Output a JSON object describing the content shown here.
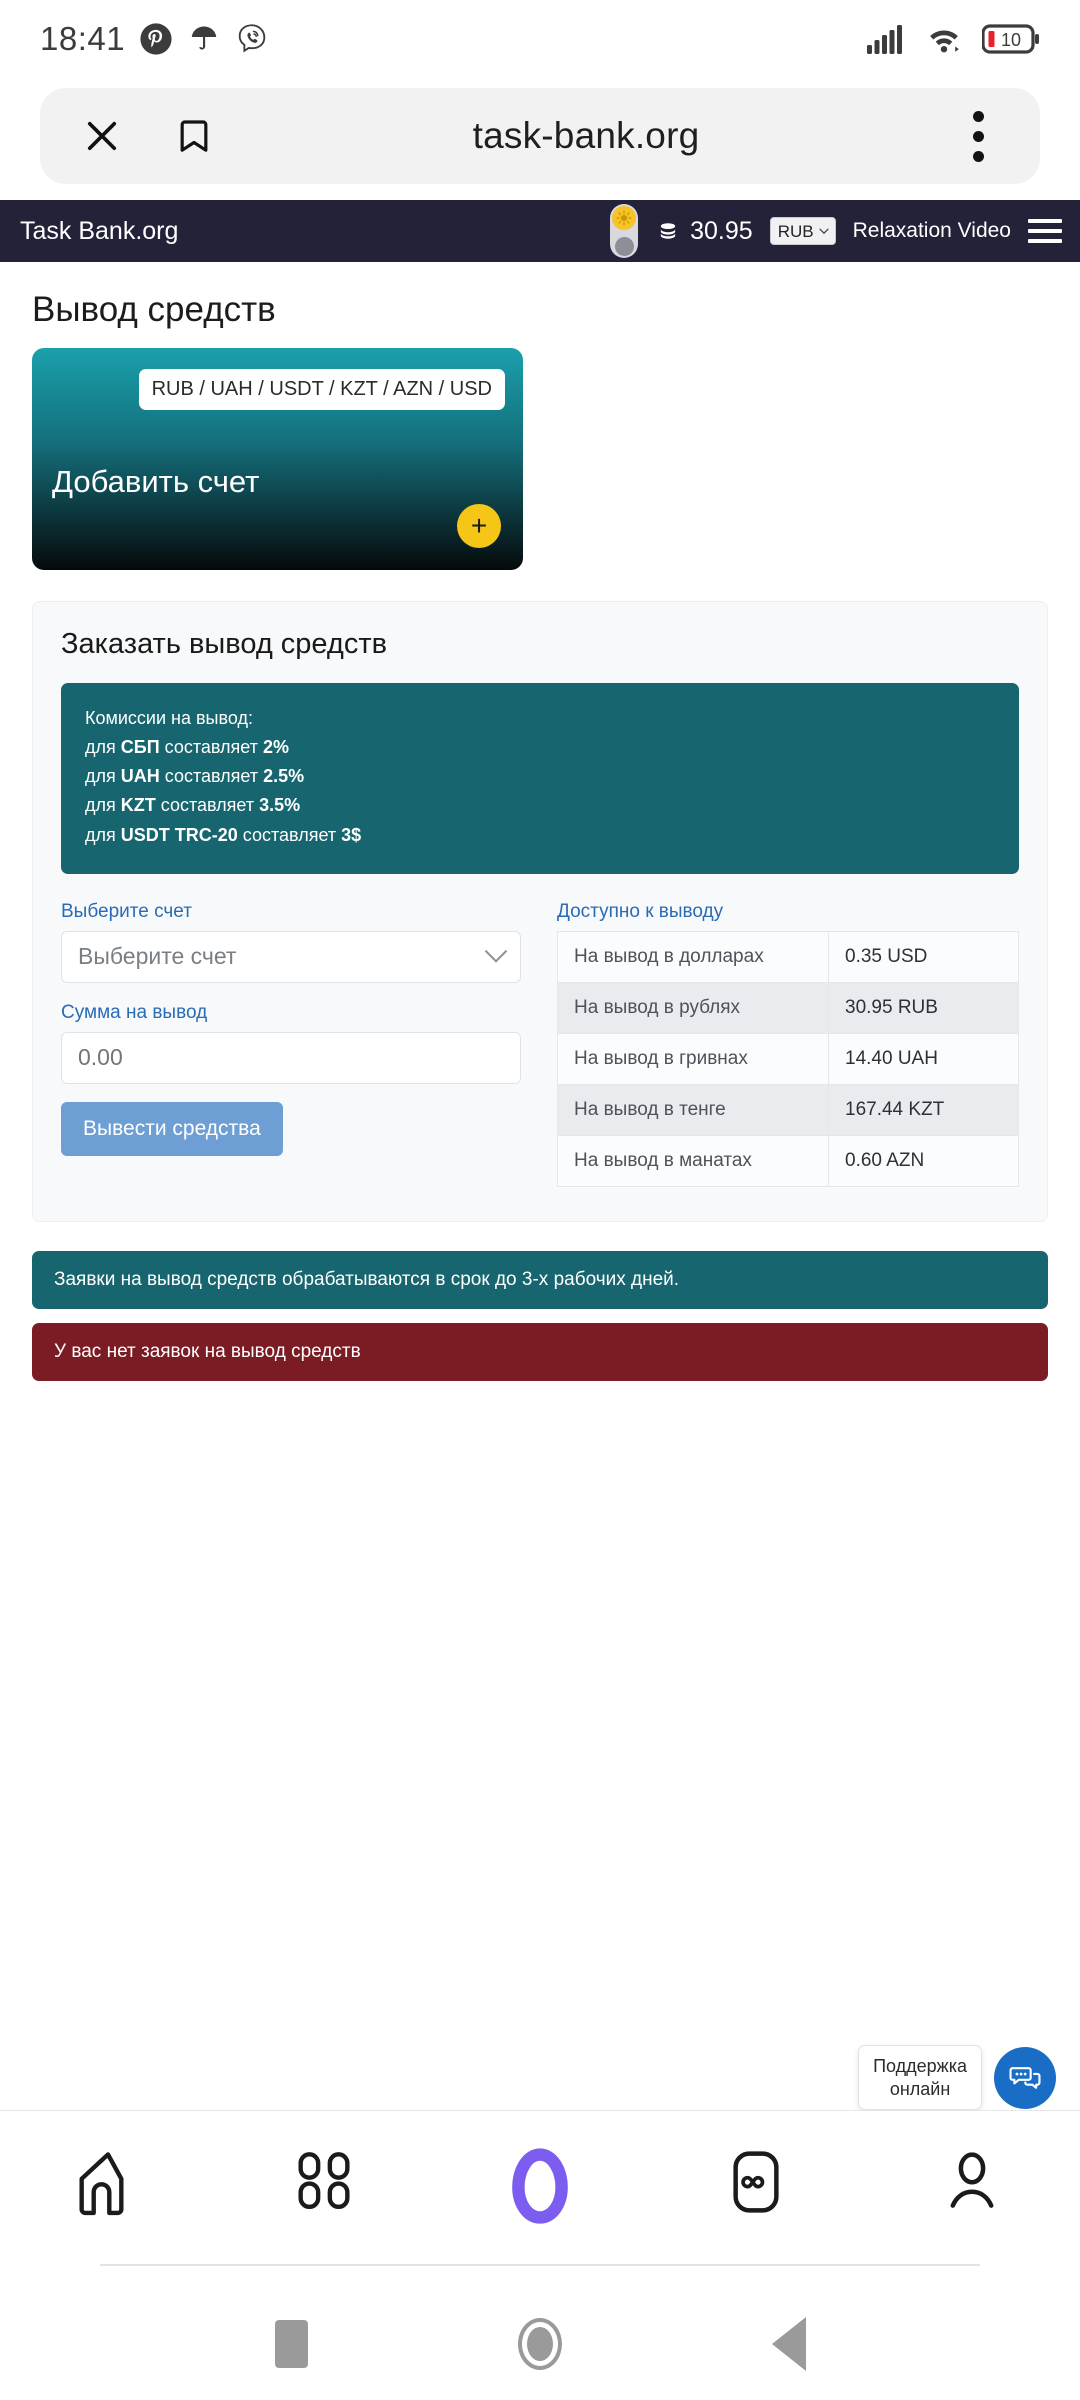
{
  "status_bar": {
    "time": "18:41",
    "notification_icons": [
      "pinterest-icon",
      "umbrella-icon",
      "viber-icon"
    ],
    "signal_icon": "cellular-signal-icon",
    "wifi_icon": "wifi-icon",
    "battery_level": "10"
  },
  "browser": {
    "url": "task-bank.org",
    "close_icon": "close-icon",
    "bookmark_icon": "bookmark-icon",
    "menu_icon": "overflow-menu-icon",
    "bottom_nav": [
      {
        "name": "home",
        "icon": "home-icon"
      },
      {
        "name": "apps",
        "icon": "grid-apps-icon"
      },
      {
        "name": "alice",
        "icon": "alice-assistant-icon"
      },
      {
        "name": "tabs",
        "icon": "infinity-tabs-icon"
      },
      {
        "name": "profile",
        "icon": "profile-icon"
      }
    ]
  },
  "android_nav": {
    "recents_icon": "recents-square-icon",
    "home_icon": "home-circle-icon",
    "back_icon": "back-triangle-icon"
  },
  "site_header": {
    "brand": "Task Bank.org",
    "theme_toggle_icon": "sun-moon-toggle-icon",
    "coins_icon": "coins-icon",
    "balance": "30.95",
    "currency_selected": "RUB",
    "currency_options": [
      "RUB",
      "UAH",
      "USDT",
      "KZT",
      "AZN",
      "USD"
    ],
    "nav_link": "Relaxation Video",
    "menu_icon": "hamburger-menu-icon",
    "bg_color": "#232238"
  },
  "main": {
    "page_title": "Вывод средств",
    "account_card": {
      "currencies_badge": "RUB / UAH / USDT / KZT / AZN / USD",
      "label": "Добавить счет",
      "add_button": "+",
      "gradient_from": "#1aa0ac",
      "gradient_to": "#050a0b",
      "add_button_color": "#f5c518"
    },
    "panel": {
      "title": "Заказать вывод средств",
      "fees": {
        "heading": "Комиссии на вывод:",
        "lines": [
          {
            "prefix": "для ",
            "method": "СБП",
            "mid": " составляет ",
            "value": "2%"
          },
          {
            "prefix": "для ",
            "method": "UAH",
            "mid": " составляет ",
            "value": "2.5%"
          },
          {
            "prefix": "для ",
            "method": "KZT",
            "mid": " составляет ",
            "value": "3.5%"
          },
          {
            "prefix": "для ",
            "method": "USDT TRC-20",
            "mid": " составляет ",
            "value": "3$"
          }
        ],
        "bg_color": "#17656e"
      },
      "form": {
        "account_label": "Выберите счет",
        "account_select_value": "Выберите счет",
        "amount_label": "Сумма на вывод",
        "amount_placeholder": "0.00",
        "amount_value": "",
        "submit_label": "Вывести средства",
        "submit_color": "#6d9fd5"
      },
      "available": {
        "title": "Доступно к выводу",
        "rows": [
          {
            "label": "На вывод в долларах",
            "value": "0.35 USD"
          },
          {
            "label": "На вывод в рублях",
            "value": "30.95 RUB"
          },
          {
            "label": "На вывод в гривнах",
            "value": "14.40 UAH"
          },
          {
            "label": "На вывод в тенге",
            "value": "167.44 KZT"
          },
          {
            "label": "На вывод в манатах",
            "value": "0.60 AZN"
          }
        ]
      }
    },
    "alerts": [
      {
        "type": "info",
        "text": "Заявки на вывод средств обрабатываются в срок до 3-х рабочих дней.",
        "color": "#17656e"
      },
      {
        "type": "danger",
        "text": "У вас нет заявок на вывод средств",
        "color": "#7b1c24"
      }
    ]
  },
  "support": {
    "tooltip_line1": "Поддержка",
    "tooltip_line2": "онлайн",
    "icon": "chat-bubbles-icon",
    "button_color": "#1a6dc4"
  }
}
